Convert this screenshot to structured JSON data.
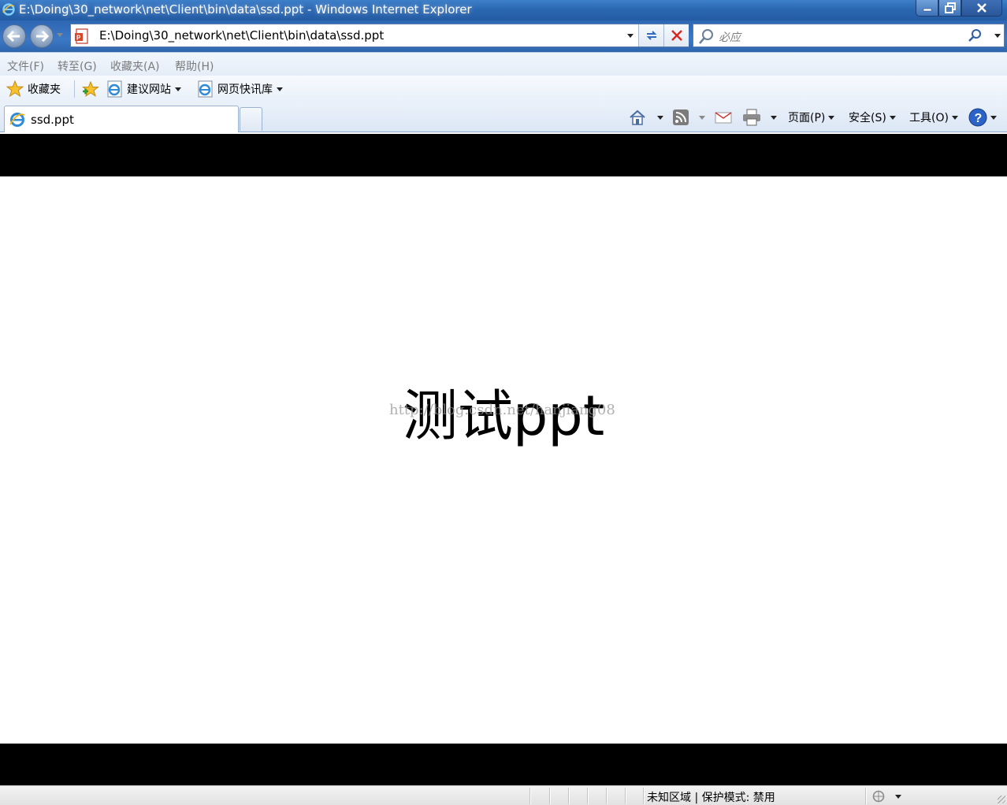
{
  "window": {
    "title": "E:\\Doing\\30_network\\net\\Client\\bin\\data\\ssd.ppt - Windows Internet Explorer"
  },
  "address": {
    "url": "E:\\Doing\\30_network\\net\\Client\\bin\\data\\ssd.ppt"
  },
  "search": {
    "placeholder": "必应"
  },
  "menu": {
    "items": [
      "文件(F)",
      "转至(G)",
      "收藏夹(A)",
      "帮助(H)"
    ]
  },
  "favorites": {
    "label": "收藏夹",
    "links": [
      "建议网站",
      "网页快讯库"
    ]
  },
  "tab": {
    "label": "ssd.ppt"
  },
  "commandbar": {
    "page_label": "页面(P)",
    "safety_label": "安全(S)",
    "tools_label": "工具(O)"
  },
  "content": {
    "slide_text": "测试ppt",
    "watermark": "http://blog.csdn.net/hanjiang08"
  },
  "statusbar": {
    "zone": "未知区域 | 保护模式: 禁用"
  },
  "colors": {
    "title_bar": "#2b67b2",
    "slide_band": "#000000",
    "slide_background": "#ffffff"
  }
}
